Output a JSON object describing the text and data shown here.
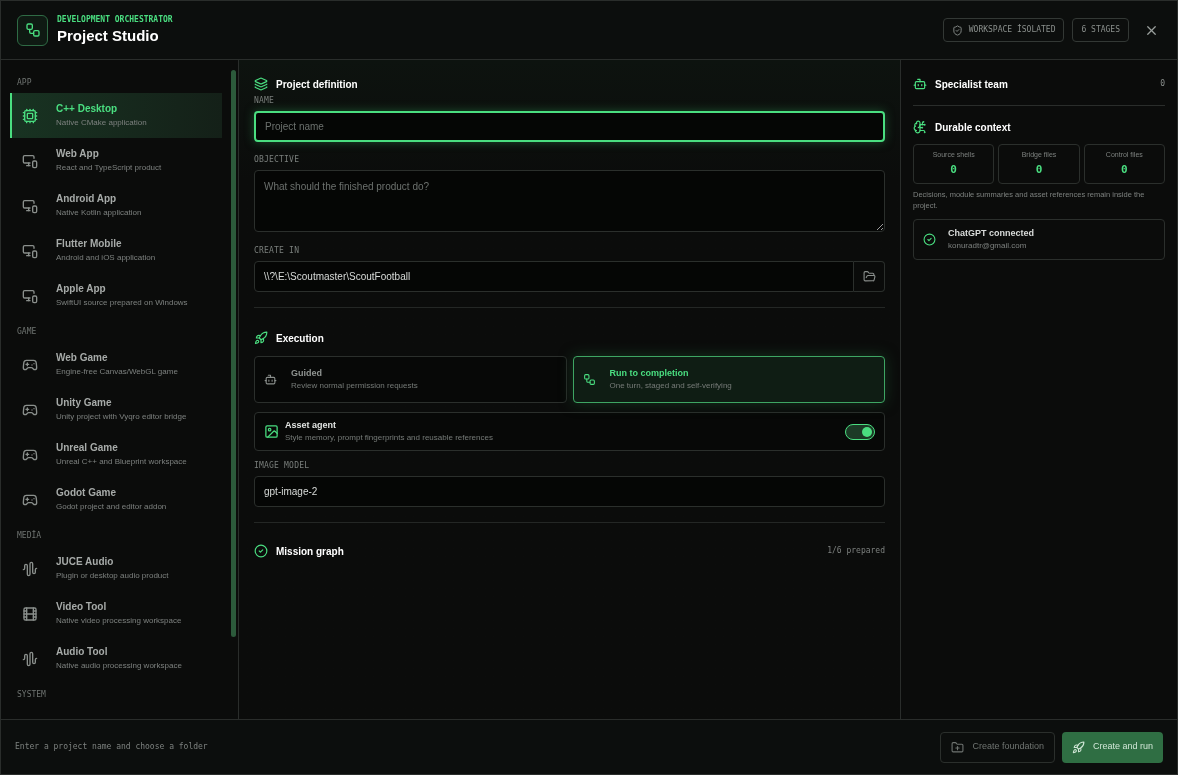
{
  "header": {
    "eyebrow": "DEVELOPMENT ORCHESTRATOR",
    "title": "Project Studio",
    "badges": [
      {
        "kind": "shield",
        "label": "WORKSPACE İSOLATED"
      },
      {
        "kind": "plain",
        "label": "6 STAGES"
      }
    ]
  },
  "sidebar": {
    "groups": [
      {
        "label": "APP",
        "items": [
          {
            "kind": "chip",
            "title": "C++ Desktop",
            "subtitle": "Native CMake application",
            "selected": true
          },
          {
            "kind": "devices",
            "title": "Web App",
            "subtitle": "React and TypeScript product",
            "selected": false
          },
          {
            "kind": "devices",
            "title": "Android App",
            "subtitle": "Native Kotlin application",
            "selected": false
          },
          {
            "kind": "devices",
            "title": "Flutter Mobile",
            "subtitle": "Android and iOS application",
            "selected": false
          },
          {
            "kind": "devices",
            "title": "Apple App",
            "subtitle": "SwiftUI source prepared on Windows",
            "selected": false
          }
        ]
      },
      {
        "label": "GAME",
        "items": [
          {
            "kind": "gamepad",
            "title": "Web Game",
            "subtitle": "Engine-free Canvas/WebGL game",
            "selected": false
          },
          {
            "kind": "gamepad",
            "title": "Unity Game",
            "subtitle": "Unity project with Vyqro editor bridge",
            "selected": false
          },
          {
            "kind": "gamepad",
            "title": "Unreal Game",
            "subtitle": "Unreal C++ and Blueprint workspace",
            "selected": false
          },
          {
            "kind": "gamepad",
            "title": "Godot Game",
            "subtitle": "Godot project and editor addon",
            "selected": false
          }
        ]
      },
      {
        "label": "MEDİA",
        "items": [
          {
            "kind": "wave",
            "title": "JUCE Audio",
            "subtitle": "Plugin or desktop audio product",
            "selected": false
          },
          {
            "kind": "film",
            "title": "Video Tool",
            "subtitle": "Native video processing workspace",
            "selected": false
          },
          {
            "kind": "wave",
            "title": "Audio Tool",
            "subtitle": "Native audio processing workspace",
            "selected": false
          }
        ]
      },
      {
        "label": "SYSTEM"
      }
    ]
  },
  "definition": {
    "title": "Project definition",
    "name_label": "NAME",
    "name_placeholder": "Project name",
    "objective_label": "OBJECTIVE",
    "objective_placeholder": "What should the finished product do?",
    "folder_label": "CREATE IN",
    "folder_value": "\\\\?\\E:\\Scoutmaster\\ScoutFootball"
  },
  "execution": {
    "title": "Execution",
    "modes": [
      {
        "kind": "bot",
        "title": "Guided",
        "subtitle": "Review normal permission requests",
        "selected": false
      },
      {
        "kind": "flow",
        "title": "Run to completion",
        "subtitle": "One turn, staged and self-verifying",
        "selected": true
      }
    ],
    "asset_agent": {
      "title": "Asset agent",
      "subtitle": "Style memory, prompt fingerprints and reusable references",
      "on": true
    },
    "model_label": "IMAGE MODEL",
    "model_value": "gpt-image-2"
  },
  "mission": {
    "title": "Mission graph",
    "status": "1/6 prepared"
  },
  "team": {
    "title": "Specialist team",
    "count": "0"
  },
  "context": {
    "title": "Durable context",
    "stats": [
      {
        "label": "Source shells",
        "value": "0"
      },
      {
        "label": "Bridge files",
        "value": "0"
      },
      {
        "label": "Control files",
        "value": "0"
      }
    ],
    "note": "Decisions, module summaries and asset references remain inside the project.",
    "connection": {
      "title": "ChatGPT connected",
      "email": "konuradtr@gmail.com"
    }
  },
  "footer": {
    "hint": "Enter a project name and choose a folder",
    "buttons": [
      {
        "kind": "secondary",
        "label": "Create foundation"
      },
      {
        "kind": "primary",
        "label": "Create and run"
      }
    ]
  }
}
